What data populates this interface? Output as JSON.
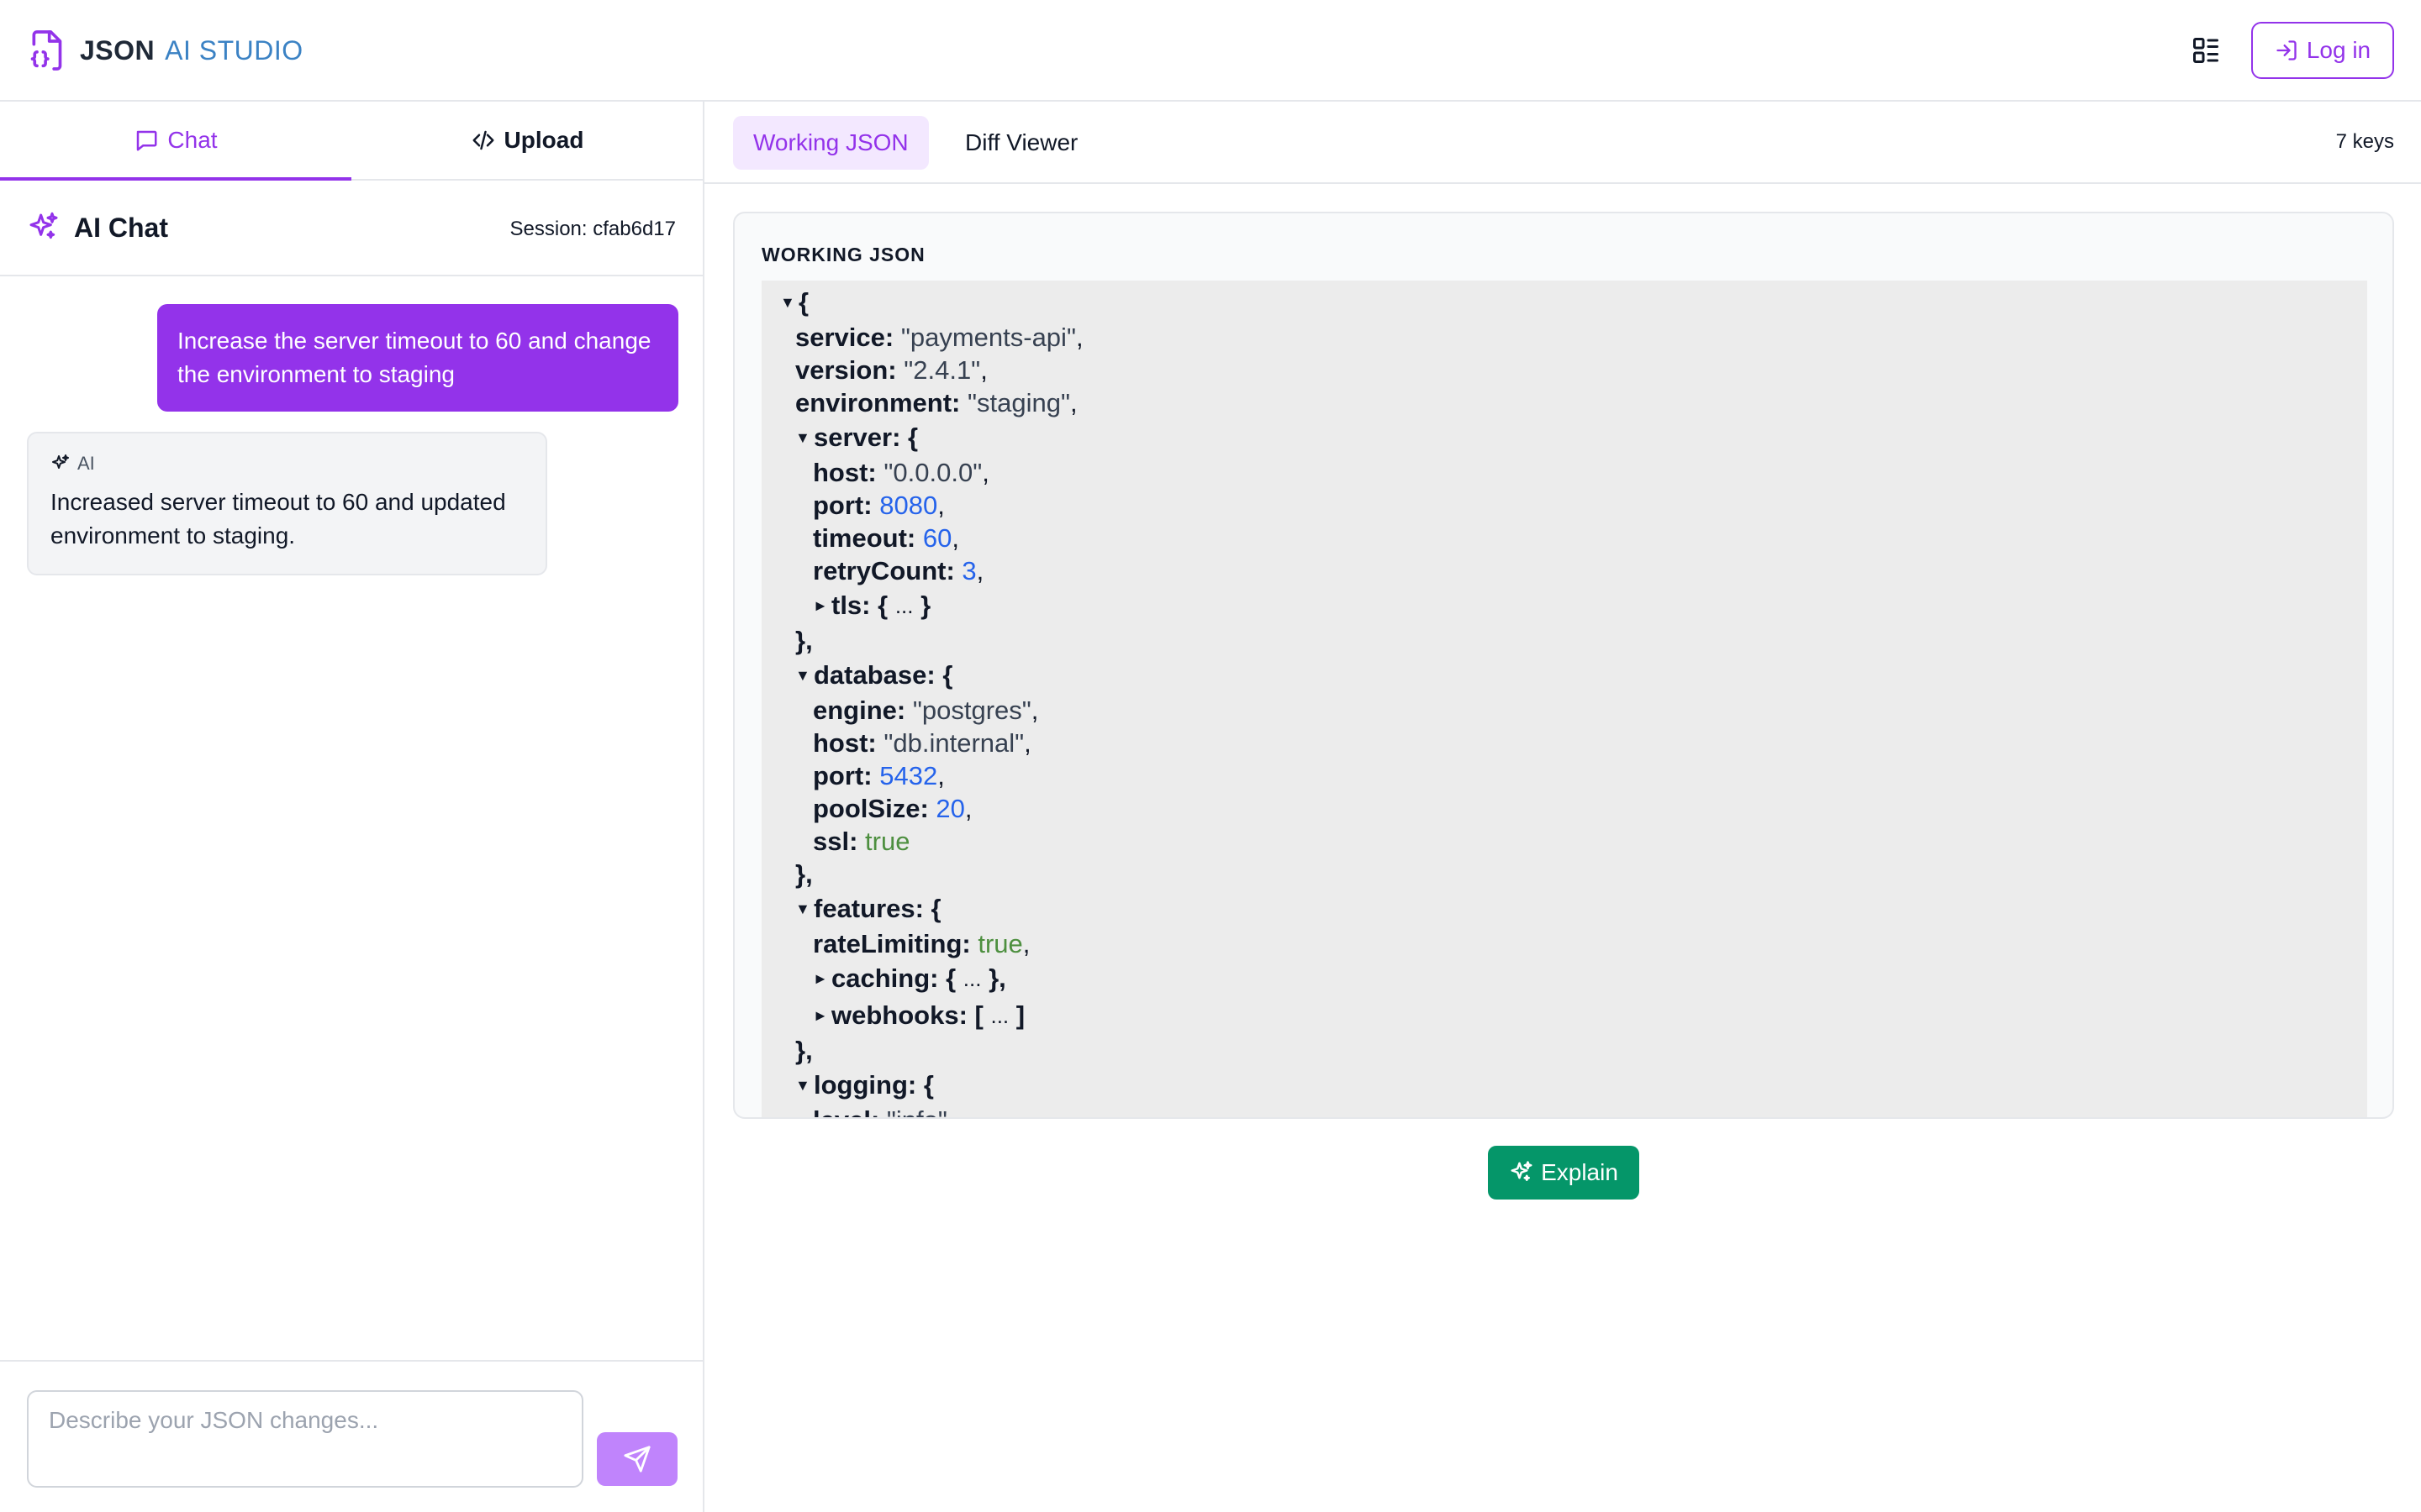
{
  "header": {
    "brand_json": "JSON",
    "brand_studio": "AI STUDIO",
    "login_label": "Log in",
    "accent_color": "#9333ea",
    "studio_color": "#3b82c4"
  },
  "left_tabs": [
    {
      "label": "Chat",
      "icon": "chat-bubble-icon",
      "active": true
    },
    {
      "label": "Upload",
      "icon": "code-icon",
      "active": false
    }
  ],
  "chat": {
    "title": "AI Chat",
    "session": "Session: cfab6d17",
    "messages": [
      {
        "role": "user",
        "text": "Increase the server timeout to 60 and change the environment to staging"
      },
      {
        "role": "ai",
        "tag": "AI",
        "text": "Increased server timeout to 60 and updated environment to staging."
      }
    ],
    "input_placeholder": "Describe your JSON changes...",
    "input_value": ""
  },
  "right_tabs": [
    {
      "label": "Working JSON",
      "active": true
    },
    {
      "label": "Diff Viewer",
      "active": false
    }
  ],
  "keys_count": "7 keys",
  "json_panel": {
    "label": "WORKING JSON",
    "lines": {
      "root_open": "{",
      "service_key": "service:",
      "service_val": "\"payments-api\"",
      "version_key": "version:",
      "version_val": "\"2.4.1\"",
      "environment_key": "environment:",
      "environment_val": "\"staging\"",
      "server_key": "server: {",
      "server_host_key": "host:",
      "server_host_val": "\"0.0.0.0\"",
      "server_port_key": "port:",
      "server_port_val": "8080",
      "server_timeout_key": "timeout:",
      "server_timeout_val": "60",
      "server_retry_key": "retryCount:",
      "server_retry_val": "3",
      "tls_key": "tls: {",
      "collapsed": "...",
      "obj_close": "}",
      "obj_close_comma": "},",
      "arr_close": "]",
      "database_key": "database: {",
      "db_engine_key": "engine:",
      "db_engine_val": "\"postgres\"",
      "db_host_key": "host:",
      "db_host_val": "\"db.internal\"",
      "db_port_key": "port:",
      "db_port_val": "5432",
      "db_pool_key": "poolSize:",
      "db_pool_val": "20",
      "db_ssl_key": "ssl:",
      "db_ssl_val": "true",
      "features_key": "features: {",
      "feat_rate_key": "rateLimiting:",
      "feat_rate_val": "true",
      "caching_key": "caching: {",
      "webhooks_key": "webhooks: [",
      "logging_key": "logging: {",
      "log_level_key": "level:",
      "log_level_val": "\"info\""
    }
  },
  "explain_label": "Explain",
  "explain_color": "#059669"
}
